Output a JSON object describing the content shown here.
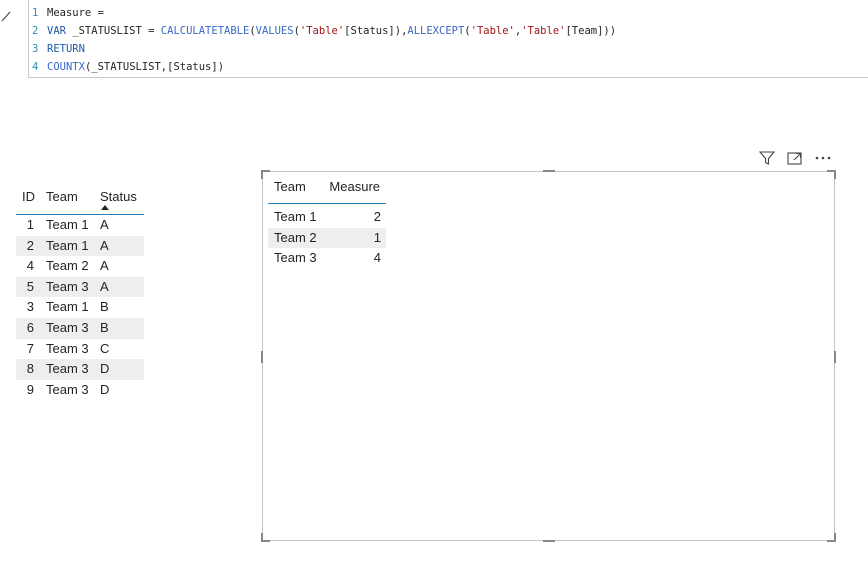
{
  "formula": {
    "lines": [
      {
        "num": "1",
        "parts": [
          {
            "t": "Measure =",
            "c": "plain"
          }
        ]
      },
      {
        "num": "2",
        "parts": [
          {
            "t": "VAR",
            "c": "kw"
          },
          {
            "t": " _STATUSLIST = ",
            "c": "plain"
          },
          {
            "t": "CALCULATETABLE",
            "c": "fn"
          },
          {
            "t": "(",
            "c": "plain"
          },
          {
            "t": "VALUES",
            "c": "fn"
          },
          {
            "t": "(",
            "c": "plain"
          },
          {
            "t": "'Table'",
            "c": "str"
          },
          {
            "t": "[Status]),",
            "c": "plain"
          },
          {
            "t": "ALLEXCEPT",
            "c": "fn"
          },
          {
            "t": "(",
            "c": "plain"
          },
          {
            "t": "'Table'",
            "c": "str"
          },
          {
            "t": ",",
            "c": "plain"
          },
          {
            "t": "'Table'",
            "c": "str"
          },
          {
            "t": "[Team]))",
            "c": "plain"
          }
        ]
      },
      {
        "num": "3",
        "parts": [
          {
            "t": "RETURN",
            "c": "kw"
          }
        ]
      },
      {
        "num": "4",
        "parts": [
          {
            "t": "COUNTX",
            "c": "fn"
          },
          {
            "t": "(_STATUSLIST,[Status])",
            "c": "plain"
          }
        ]
      }
    ]
  },
  "left_table": {
    "headers": {
      "id": "ID",
      "team": "Team",
      "status": "Status"
    },
    "rows": [
      {
        "id": "1",
        "team": "Team 1",
        "status": "A"
      },
      {
        "id": "2",
        "team": "Team 1",
        "status": "A"
      },
      {
        "id": "4",
        "team": "Team 2",
        "status": "A"
      },
      {
        "id": "5",
        "team": "Team 3",
        "status": "A"
      },
      {
        "id": "3",
        "team": "Team 1",
        "status": "B"
      },
      {
        "id": "6",
        "team": "Team 3",
        "status": "B"
      },
      {
        "id": "7",
        "team": "Team 3",
        "status": "C"
      },
      {
        "id": "8",
        "team": "Team 3",
        "status": "D"
      },
      {
        "id": "9",
        "team": "Team 3",
        "status": "D"
      }
    ]
  },
  "visual": {
    "header_icons": [
      "filter-icon",
      "focus-mode-icon",
      "more-options-icon"
    ],
    "table": {
      "headers": {
        "team": "Team",
        "measure": "Measure"
      },
      "rows": [
        {
          "team": "Team 1",
          "measure": "2"
        },
        {
          "team": "Team 2",
          "measure": "1"
        },
        {
          "team": "Team 3",
          "measure": "4"
        }
      ]
    }
  },
  "colors": {
    "accent": "#2c7fb8",
    "alt_row": "#eeeeee",
    "keyword": "#1e5aa8",
    "string": "#a31515"
  }
}
